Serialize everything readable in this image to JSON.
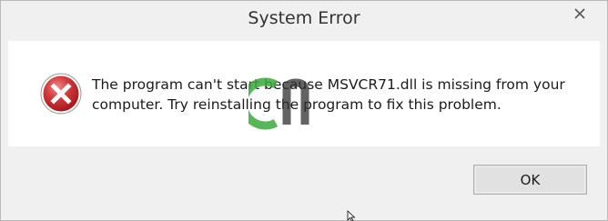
{
  "window": {
    "title": "System Error",
    "close_icon": "close-x-icon"
  },
  "message": {
    "icon": "error-icon",
    "text": "The program can't start because MSVCR71.dll is missing from your computer. Try reinstalling the program to fix this problem."
  },
  "buttons": {
    "ok_label": "OK"
  },
  "colors": {
    "error_red": "#d0393d",
    "content_bg": "#ffffff",
    "chrome_bg": "#f0f0f0",
    "watermark_green": "#3aa93a"
  }
}
